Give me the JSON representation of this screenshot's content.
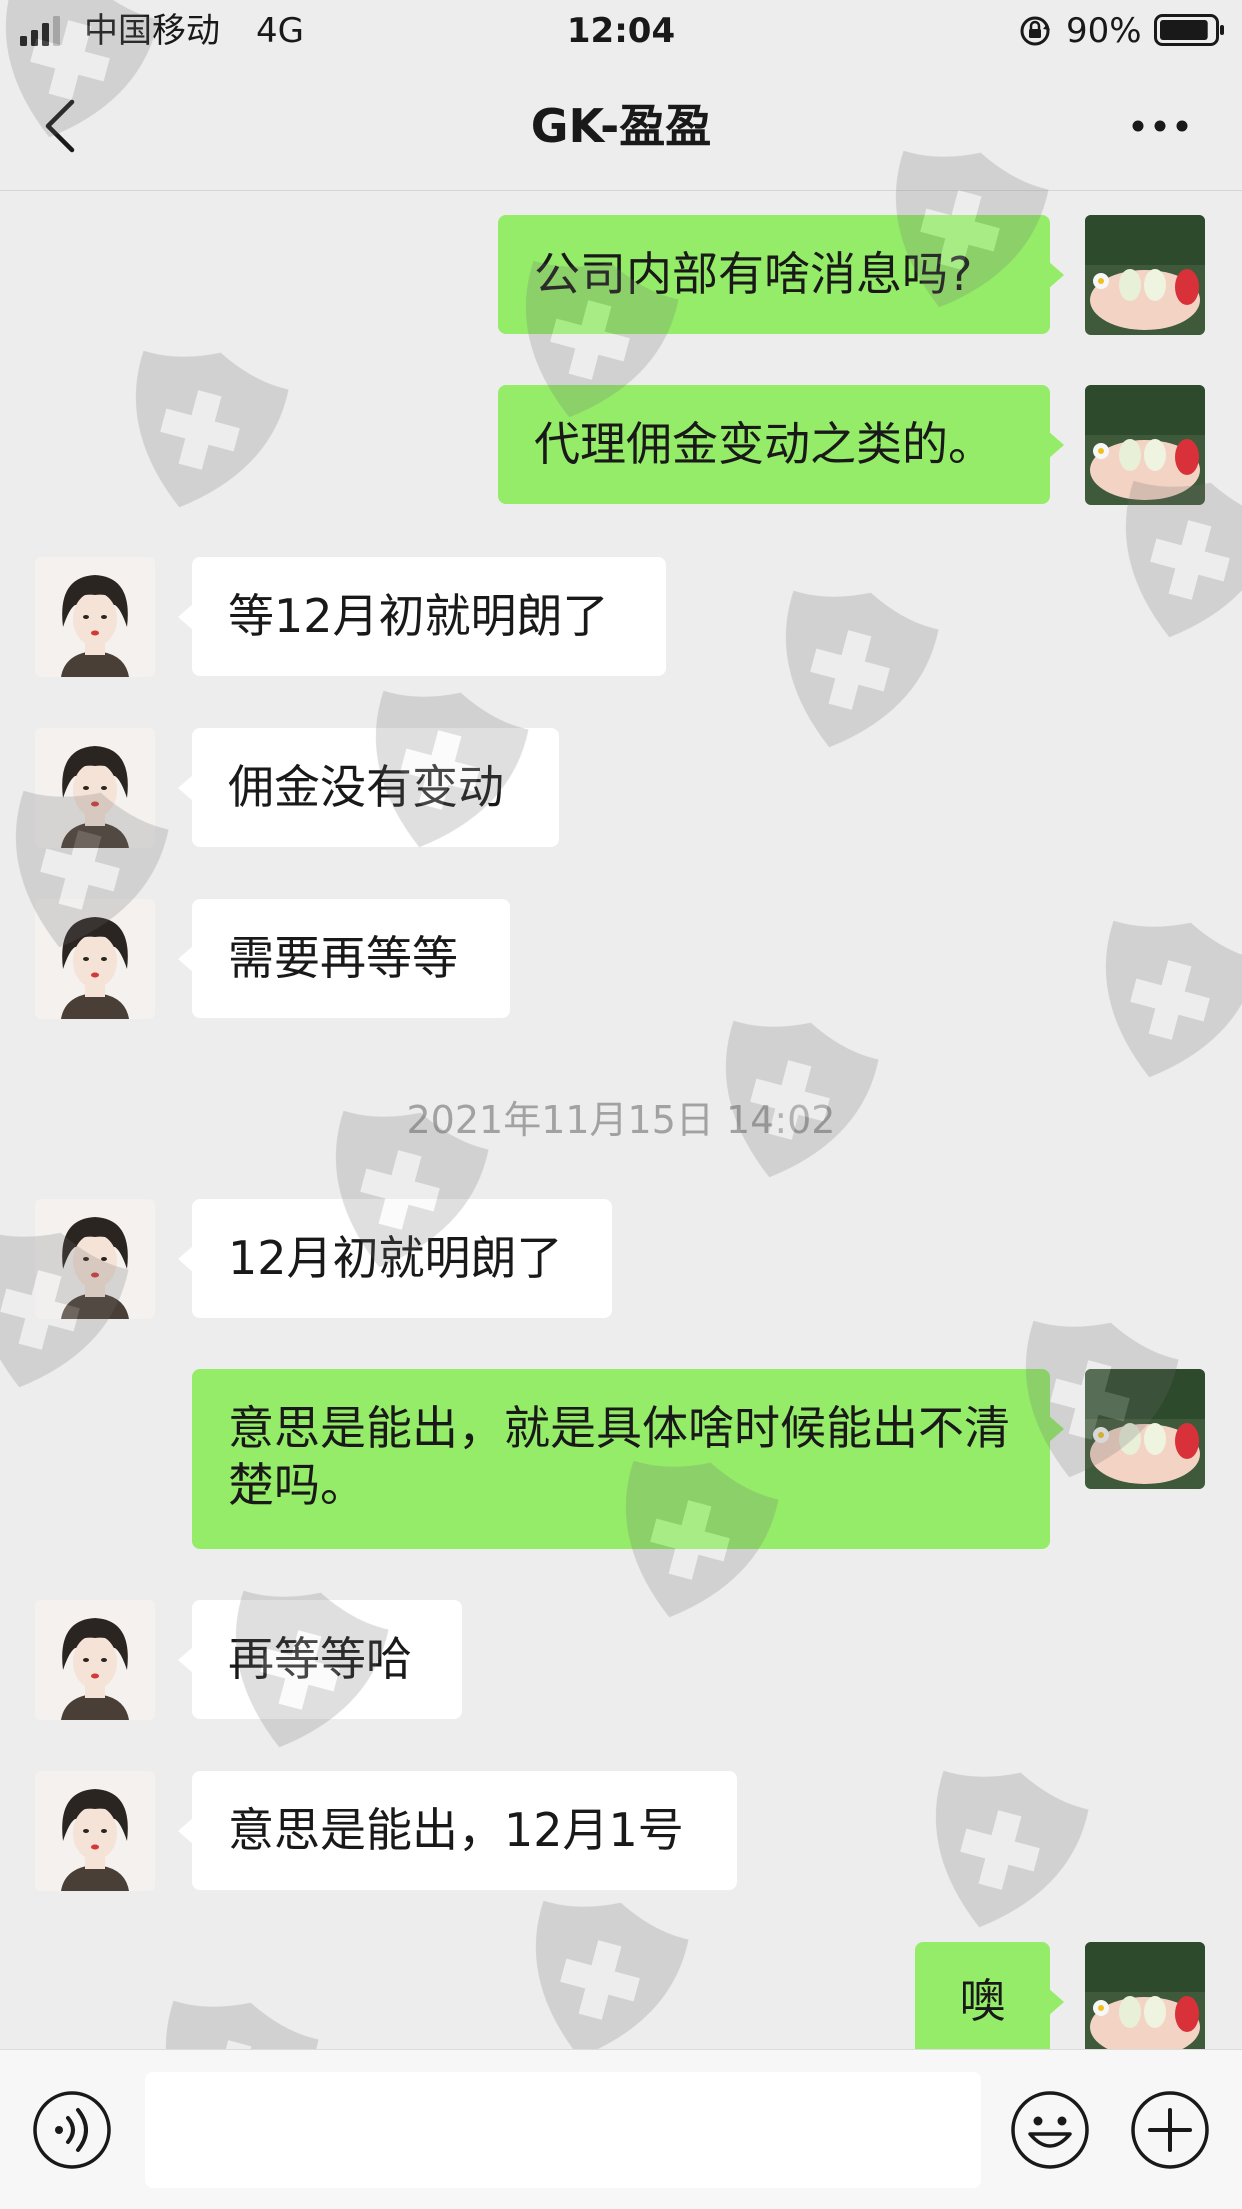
{
  "status_bar": {
    "carrier": "中国移动",
    "network": "4G",
    "time": "12:04",
    "battery": "90%",
    "battery_level": 0.9
  },
  "nav": {
    "title": "GK-盈盈",
    "back_icon": "chevron-left-icon",
    "more_icon": "more-dots-icon"
  },
  "messages": [
    {
      "sender": "me",
      "text": "公司内部有啥消息吗?"
    },
    {
      "sender": "me",
      "text": "代理佣金变动之类的。"
    },
    {
      "sender": "other",
      "text": "等12月初就明朗了"
    },
    {
      "sender": "other",
      "text": "佣金没有变动"
    },
    {
      "sender": "other",
      "text": "需要再等等"
    },
    {
      "sender": "other",
      "text": "12月初就明朗了"
    },
    {
      "sender": "me",
      "text": "意思是能出，就是具体啥时候能出不清楚吗。"
    },
    {
      "sender": "other",
      "text": "再等等哈"
    },
    {
      "sender": "other",
      "text": "意思是能出，12月1号"
    },
    {
      "sender": "me",
      "text": "噢"
    }
  ],
  "timestamp": "2021年11月15日 14:02",
  "input_bar": {
    "placeholder": "",
    "voice_icon": "voice-icon",
    "emoji_icon": "emoji-icon",
    "plus_icon": "plus-icon"
  },
  "colors": {
    "my_bubble": "#95ec69",
    "their_bubble": "#ffffff",
    "background": "#ededed"
  }
}
